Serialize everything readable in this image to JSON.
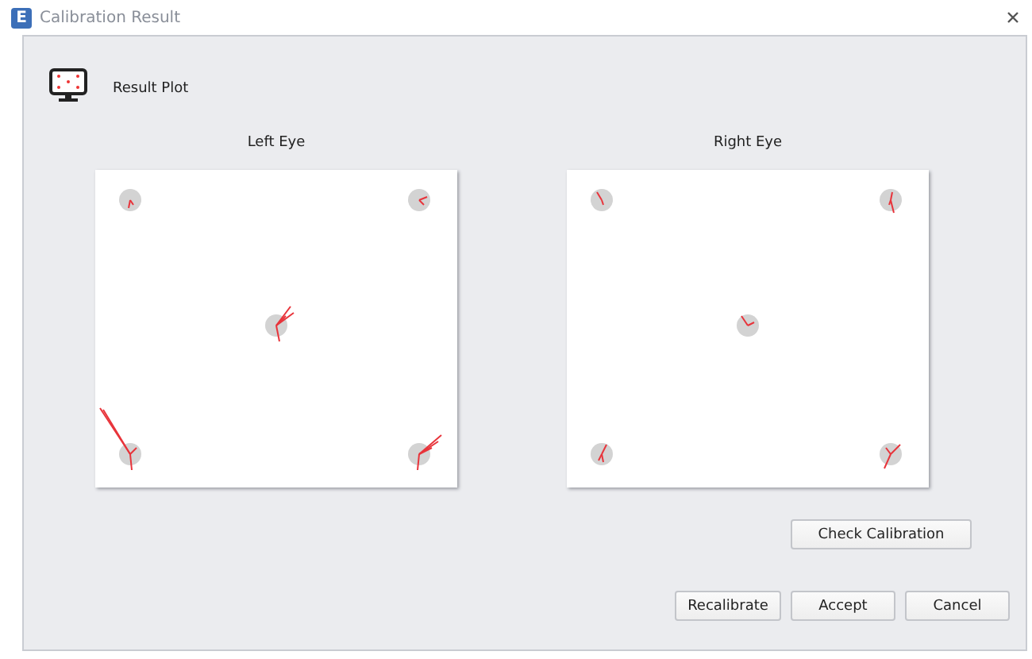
{
  "window": {
    "app_letter": "E",
    "title": "Calibration Result"
  },
  "header": {
    "label": "Result Plot"
  },
  "plots": [
    {
      "title": "Left Eye"
    },
    {
      "title": "Right Eye"
    }
  ],
  "check_button": "Check Calibration",
  "buttons": [
    "Recalibrate",
    "Accept",
    "Cancel"
  ]
}
